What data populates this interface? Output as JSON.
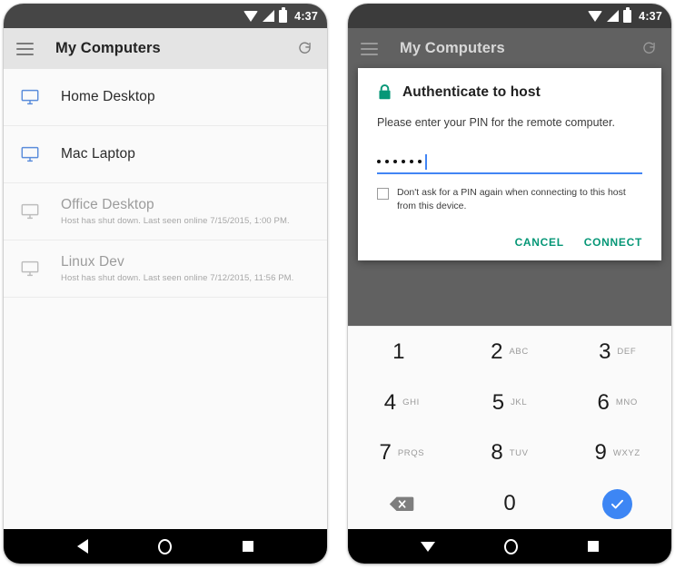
{
  "colors": {
    "accent_blue": "#4285f4",
    "accent_teal": "#079777",
    "status_bar": "#464646",
    "app_bar": "#e4e4e4",
    "scrim": "#616161",
    "key_ok_blue": "#3d86f4",
    "offline_text": "#9c9c9c"
  },
  "left_phone": {
    "status_bar": {
      "time": "4:37",
      "icons": [
        "wifi-icon",
        "signal-icon",
        "battery-icon"
      ]
    },
    "app_bar": {
      "menu_icon": "hamburger-icon",
      "title": "My Computers",
      "refresh_icon": "refresh-icon"
    },
    "computers": [
      {
        "name": "Home Desktop",
        "status": "",
        "online": true,
        "icon": "monitor-icon"
      },
      {
        "name": "Mac Laptop",
        "status": "",
        "online": true,
        "icon": "monitor-icon"
      },
      {
        "name": "Office Desktop",
        "status": "Host has shut down. Last seen online 7/15/2015, 1:00 PM.",
        "online": false,
        "icon": "monitor-icon"
      },
      {
        "name": "Linux Dev",
        "status": "Host has shut down. Last seen online 7/12/2015, 11:56 PM.",
        "online": false,
        "icon": "monitor-icon"
      }
    ],
    "nav_bar": {
      "back_icon": "back-triangle-icon",
      "home_icon": "home-circle-icon",
      "recents_icon": "recents-square-icon"
    }
  },
  "right_phone": {
    "status_bar": {
      "time": "4:37",
      "icons": [
        "wifi-icon",
        "signal-icon",
        "battery-icon"
      ]
    },
    "app_bar": {
      "menu_icon": "hamburger-icon",
      "title": "My Computers",
      "refresh_icon": "refresh-icon"
    },
    "dialog": {
      "lock_icon": "lock-icon",
      "title": "Authenticate to host",
      "message": "Please enter your PIN for the remote computer.",
      "pin_input": {
        "value": "••••••",
        "masked_length": 6,
        "placeholder": ""
      },
      "checkbox": {
        "checked": false,
        "label": "Don't ask for a PIN again when connecting to this host from this device."
      },
      "cancel_label": "CANCEL",
      "connect_label": "CONNECT"
    },
    "keypad": {
      "keys": [
        {
          "num": "1",
          "letters": "",
          "type": "digit"
        },
        {
          "num": "2",
          "letters": "ABC",
          "type": "digit"
        },
        {
          "num": "3",
          "letters": "DEF",
          "type": "digit"
        },
        {
          "num": "4",
          "letters": "GHI",
          "type": "digit"
        },
        {
          "num": "5",
          "letters": "JKL",
          "type": "digit"
        },
        {
          "num": "6",
          "letters": "MNO",
          "type": "digit"
        },
        {
          "num": "7",
          "letters": "PRQS",
          "type": "digit"
        },
        {
          "num": "8",
          "letters": "TUV",
          "type": "digit"
        },
        {
          "num": "9",
          "letters": "WXYZ",
          "type": "digit"
        },
        {
          "num": "",
          "letters": "",
          "type": "backspace",
          "icon": "backspace-icon"
        },
        {
          "num": "0",
          "letters": "",
          "type": "digit"
        },
        {
          "num": "",
          "letters": "",
          "type": "submit",
          "icon": "check-icon"
        }
      ]
    },
    "nav_bar": {
      "back_icon": "dismiss-keyboard-triangle-icon",
      "home_icon": "home-circle-icon",
      "recents_icon": "recents-square-icon"
    }
  }
}
